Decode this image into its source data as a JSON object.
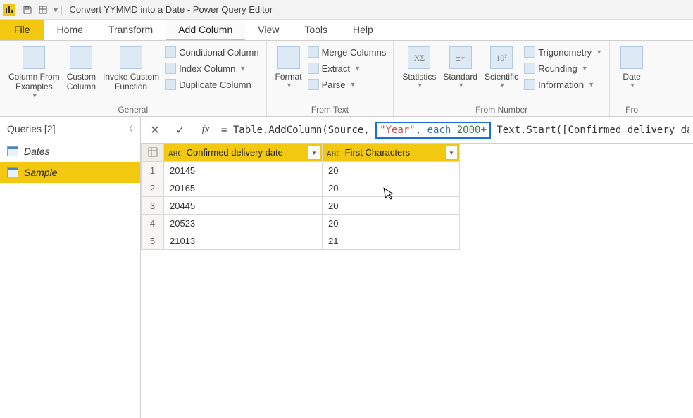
{
  "titlebar": {
    "title": "Convert YYMMD into a Date - Power Query Editor"
  },
  "tabs": {
    "file": "File",
    "home": "Home",
    "transform": "Transform",
    "add_column": "Add Column",
    "view": "View",
    "tools": "Tools",
    "help": "Help"
  },
  "ribbon": {
    "general": {
      "label": "General",
      "column_from_examples": "Column From\nExamples",
      "custom_column": "Custom\nColumn",
      "invoke_custom_function": "Invoke Custom\nFunction",
      "conditional_column": "Conditional Column",
      "index_column": "Index Column",
      "duplicate_column": "Duplicate Column"
    },
    "from_text": {
      "label": "From Text",
      "format": "Format",
      "merge_columns": "Merge Columns",
      "extract": "Extract",
      "parse": "Parse"
    },
    "from_number": {
      "label": "From Number",
      "statistics": "Statistics",
      "standard": "Standard",
      "scientific": "Scientific",
      "trigonometry": "Trigonometry",
      "rounding": "Rounding",
      "information": "Information"
    },
    "date_time": {
      "label": "Fro",
      "date": "Date"
    }
  },
  "sidebar": {
    "header": "Queries [2]",
    "items": [
      {
        "label": "Dates"
      },
      {
        "label": "Sample"
      }
    ]
  },
  "formula": {
    "prefix": "= Table.AddColumn(Source, ",
    "hl_str": "\"Year\"",
    "hl_sep": ", ",
    "hl_kw": "each",
    "hl_sp": " ",
    "hl_num": "2000+",
    "suffix": " Text.Start([Confirmed delivery da"
  },
  "grid": {
    "columns": [
      {
        "name": "Confirmed delivery date",
        "type": "ABC"
      },
      {
        "name": "First Characters",
        "type": "ABC"
      }
    ],
    "rows": [
      {
        "c1": "20145",
        "c2": "20"
      },
      {
        "c1": "20165",
        "c2": "20"
      },
      {
        "c1": "20445",
        "c2": "20"
      },
      {
        "c1": "20523",
        "c2": "20"
      },
      {
        "c1": "21013",
        "c2": "21"
      }
    ],
    "rownums": [
      "1",
      "2",
      "3",
      "4",
      "5"
    ]
  }
}
